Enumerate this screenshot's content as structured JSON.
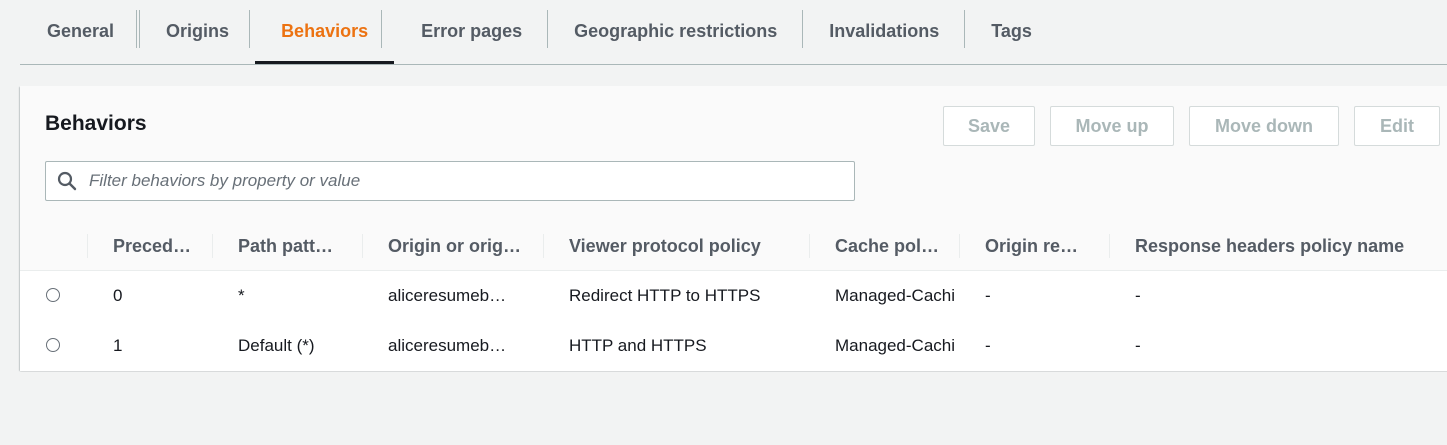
{
  "tabs": [
    {
      "label": "General"
    },
    {
      "label": "Origins"
    },
    {
      "label": "Behaviors"
    },
    {
      "label": "Error pages"
    },
    {
      "label": "Geographic restrictions"
    },
    {
      "label": "Invalidations"
    },
    {
      "label": "Tags"
    }
  ],
  "active_tab": "Behaviors",
  "panel": {
    "title": "Behaviors",
    "buttons": {
      "save": "Save",
      "move_up": "Move up",
      "move_down": "Move down",
      "edit": "Edit"
    },
    "filter_placeholder": "Filter behaviors by property or value"
  },
  "table": {
    "columns": [
      "Preced…",
      "Path patt…",
      "Origin or orig…",
      "Viewer protocol policy",
      "Cache pol…",
      "Origin re…",
      "Response headers policy name"
    ],
    "rows": [
      {
        "precedence": "0",
        "path": "*",
        "origin": "aliceresumeb…",
        "viewer_protocol": "Redirect HTTP to HTTPS",
        "cache_policy": "Managed-Cachi",
        "origin_request": "-",
        "response_headers": "-"
      },
      {
        "precedence": "1",
        "path": "Default (*)",
        "origin": "aliceresumeb…",
        "viewer_protocol": "HTTP and HTTPS",
        "cache_policy": "Managed-Cachi",
        "origin_request": "-",
        "response_headers": "-"
      }
    ]
  },
  "colors": {
    "accent": "#ec7211",
    "background": "#f2f3f3",
    "disabled_text": "#aab7b8"
  }
}
